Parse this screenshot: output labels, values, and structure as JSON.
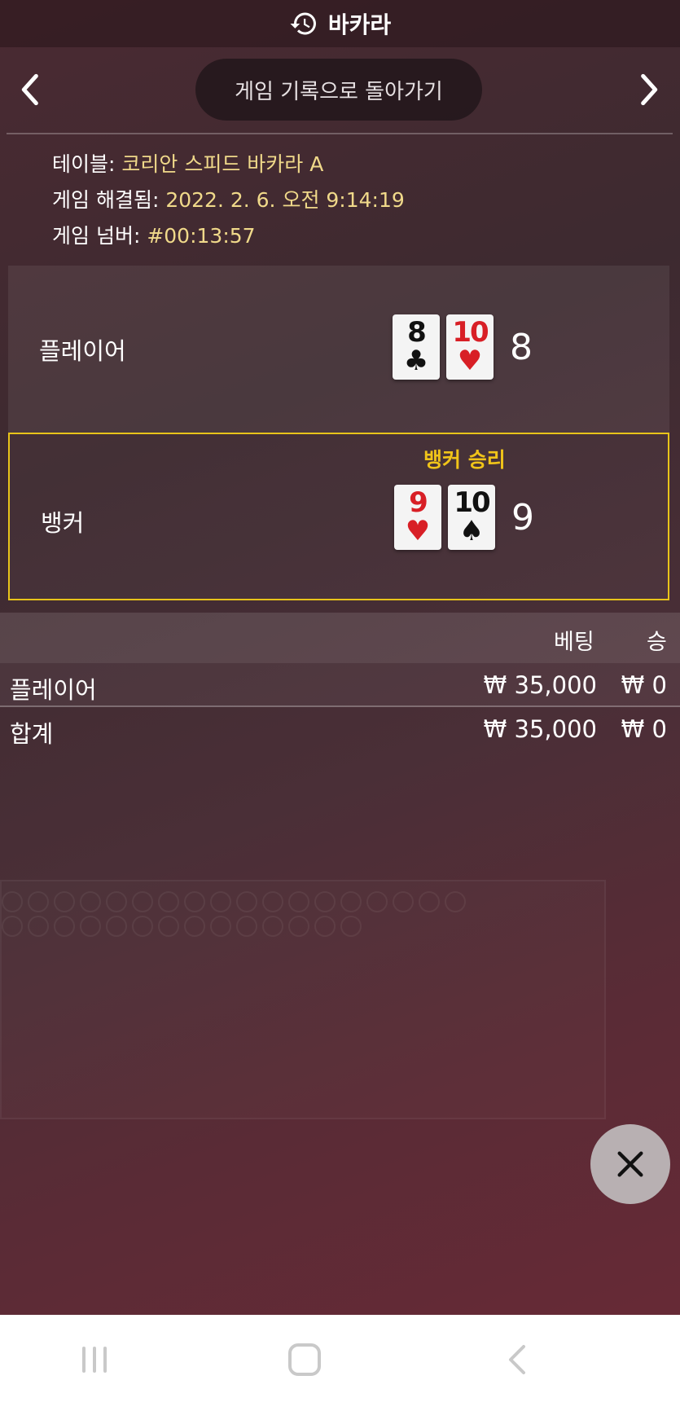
{
  "header": {
    "title": "바카라",
    "icon": "history-icon"
  },
  "nav": {
    "back_label": "게임 기록으로 돌아가기",
    "prev_icon": "chevron-left-icon",
    "next_icon": "chevron-right-icon"
  },
  "info": {
    "table_label": "테이블:",
    "table_value": "코리안 스피드 바카라 A",
    "resolved_label": "게임 해결됨:",
    "resolved_value": "2022. 2. 6. 오전 9:14:19",
    "number_label": "게임 넘버:",
    "number_value": "#00:13:57"
  },
  "hands": {
    "player": {
      "name": "플레이어",
      "cards": [
        {
          "rank": "8",
          "suit": "♣",
          "color": "black"
        },
        {
          "rank": "10",
          "suit": "♥",
          "color": "red"
        }
      ],
      "total": "8"
    },
    "banker": {
      "name": "뱅커",
      "winner_label": "뱅커 승리",
      "cards": [
        {
          "rank": "9",
          "suit": "♥",
          "color": "red"
        },
        {
          "rank": "10",
          "suit": "♠",
          "color": "black"
        }
      ],
      "total": "9"
    }
  },
  "bets": {
    "headers": {
      "bet": "베팅",
      "win": "승"
    },
    "rows": [
      {
        "name": "플레이어",
        "bet": "₩ 35,000",
        "win": "₩ 0"
      }
    ],
    "total": {
      "name": "합계",
      "bet": "₩ 35,000",
      "win": "₩ 0"
    }
  },
  "close_icon": "close-icon",
  "colors": {
    "accent_yellow": "#e8c41a",
    "card_red": "#d81f26"
  }
}
